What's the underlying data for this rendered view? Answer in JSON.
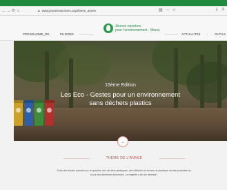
{
  "browser": {
    "nav_icons": [
      "back-icon",
      "forward-icon",
      "refresh-icon",
      "home-icon"
    ],
    "url": "www.jeunesreporters.org/theme_annee",
    "right_icons": [
      "star-icon",
      "menu-icon"
    ]
  },
  "site_nav": {
    "items": [
      "PROGRAMME_DD",
      "PILIERES",
      "ACTUALITÉS",
      "OUTILS"
    ],
    "logo_line1": "Jeunes reporters",
    "logo_line2": "pour l'environnement - Maroc"
  },
  "hero": {
    "edition": "15ème Edition",
    "title_line1": "Les Eco - Gestes pour un environnement",
    "title_line2": "sans déchets plastics"
  },
  "theme": {
    "title": "THÈME DE L'ANNÉE",
    "body_line1": "Selon les études menées sur la question des déchets plastiques, des milliards de tonnes de plastique ont été produites au",
    "body_line2": "cours des dernières décennies. La majorité a fini en déchets !"
  },
  "colors": {
    "accent_green": "#1f8a3c",
    "theme_red": "#b6584a"
  }
}
